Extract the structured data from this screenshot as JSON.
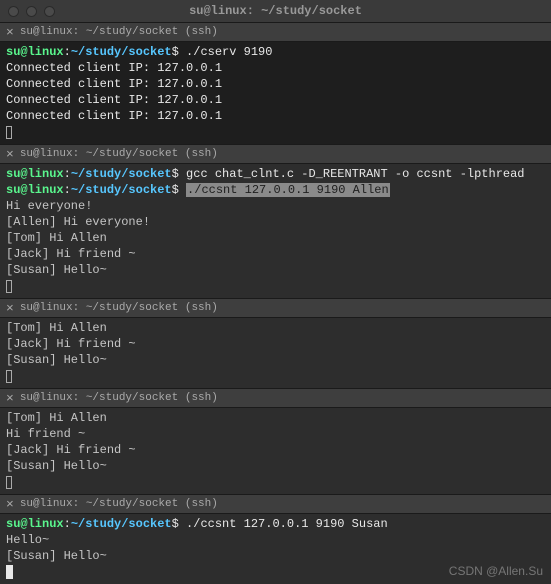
{
  "titlebar": {
    "title": "su@linux: ~/study/socket"
  },
  "tabs": {
    "label": "su@linux: ~/study/socket (ssh)"
  },
  "prompt": {
    "user": "su@linux",
    "sep": ":",
    "path": "~/study/socket",
    "sym": "$"
  },
  "panes": [
    {
      "type": "server",
      "cmd": "./cserv 9190",
      "output": [
        "Connected client IP: 127.0.0.1",
        "Connected client IP: 127.0.0.1",
        "Connected client IP: 127.0.0.1",
        "Connected client IP: 127.0.0.1"
      ],
      "cursor": "outline"
    },
    {
      "type": "client",
      "cmds": [
        {
          "text": "gcc chat_clnt.c -D_REENTRANT -o ccsnt -lpthread",
          "highlight": false
        },
        {
          "text": "./ccsnt 127.0.0.1 9190 Allen",
          "highlight": true
        }
      ],
      "output": [
        "Hi everyone!",
        "[Allen] Hi everyone!",
        "[Tom] Hi Allen",
        "[Jack] Hi friend ~",
        "[Susan] Hello~"
      ],
      "cursor": "outline"
    },
    {
      "type": "output-only",
      "output": [
        "[Tom] Hi Allen",
        "[Jack] Hi friend ~",
        "[Susan] Hello~"
      ],
      "cursor": "outline"
    },
    {
      "type": "output-only",
      "output": [
        "[Tom] Hi Allen",
        "Hi friend ~",
        "[Jack] Hi friend ~",
        "[Susan] Hello~"
      ],
      "cursor": "outline"
    },
    {
      "type": "client",
      "cmds": [
        {
          "text": "./ccsnt 127.0.0.1 9190 Susan",
          "highlight": false
        }
      ],
      "output": [
        "Hello~",
        "[Susan] Hello~"
      ],
      "cursor": "solid"
    }
  ],
  "watermark": "CSDN @Allen.Su"
}
